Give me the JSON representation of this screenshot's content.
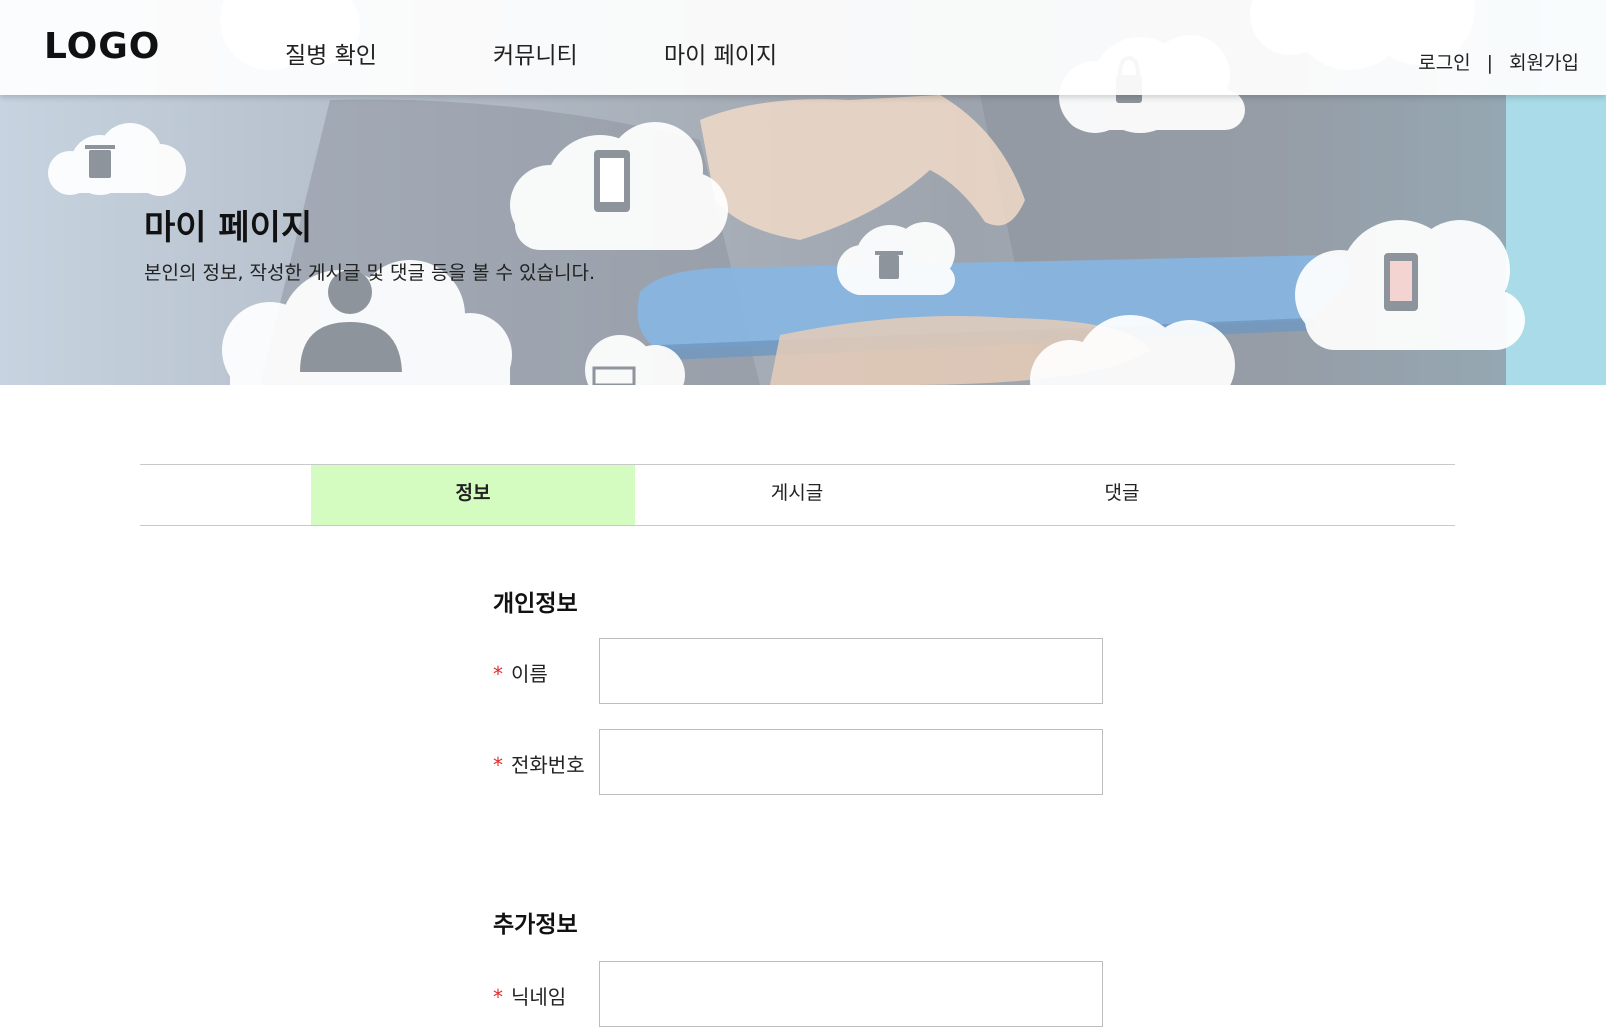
{
  "header": {
    "logo": "LOGO",
    "nav": [
      "질병 확인",
      "커뮤니티",
      "마이 페이지"
    ],
    "auth": {
      "login": "로그인",
      "separator": "|",
      "signup": "회원가입"
    }
  },
  "hero": {
    "title": "마이 페이지",
    "subtitle": "본인의 정보, 작성한 게시글 및 댓글 등을 볼 수 있습니다."
  },
  "tabs": [
    {
      "label": "정보",
      "active": true
    },
    {
      "label": "게시글",
      "active": false
    },
    {
      "label": "댓글",
      "active": false
    }
  ],
  "form": {
    "personal": {
      "title": "개인정보",
      "fields": [
        {
          "required_mark": "*",
          "label": "이름",
          "value": "",
          "placeholder": ""
        },
        {
          "required_mark": "*",
          "label": "전화번호",
          "value": "",
          "placeholder": ""
        }
      ]
    },
    "extra": {
      "title": "추가정보",
      "fields": [
        {
          "required_mark": "*",
          "label": "닉네임",
          "value": "",
          "placeholder": ""
        }
      ]
    }
  },
  "colors": {
    "active_tab": "#d5fcc0",
    "required": "#e02b2b"
  }
}
